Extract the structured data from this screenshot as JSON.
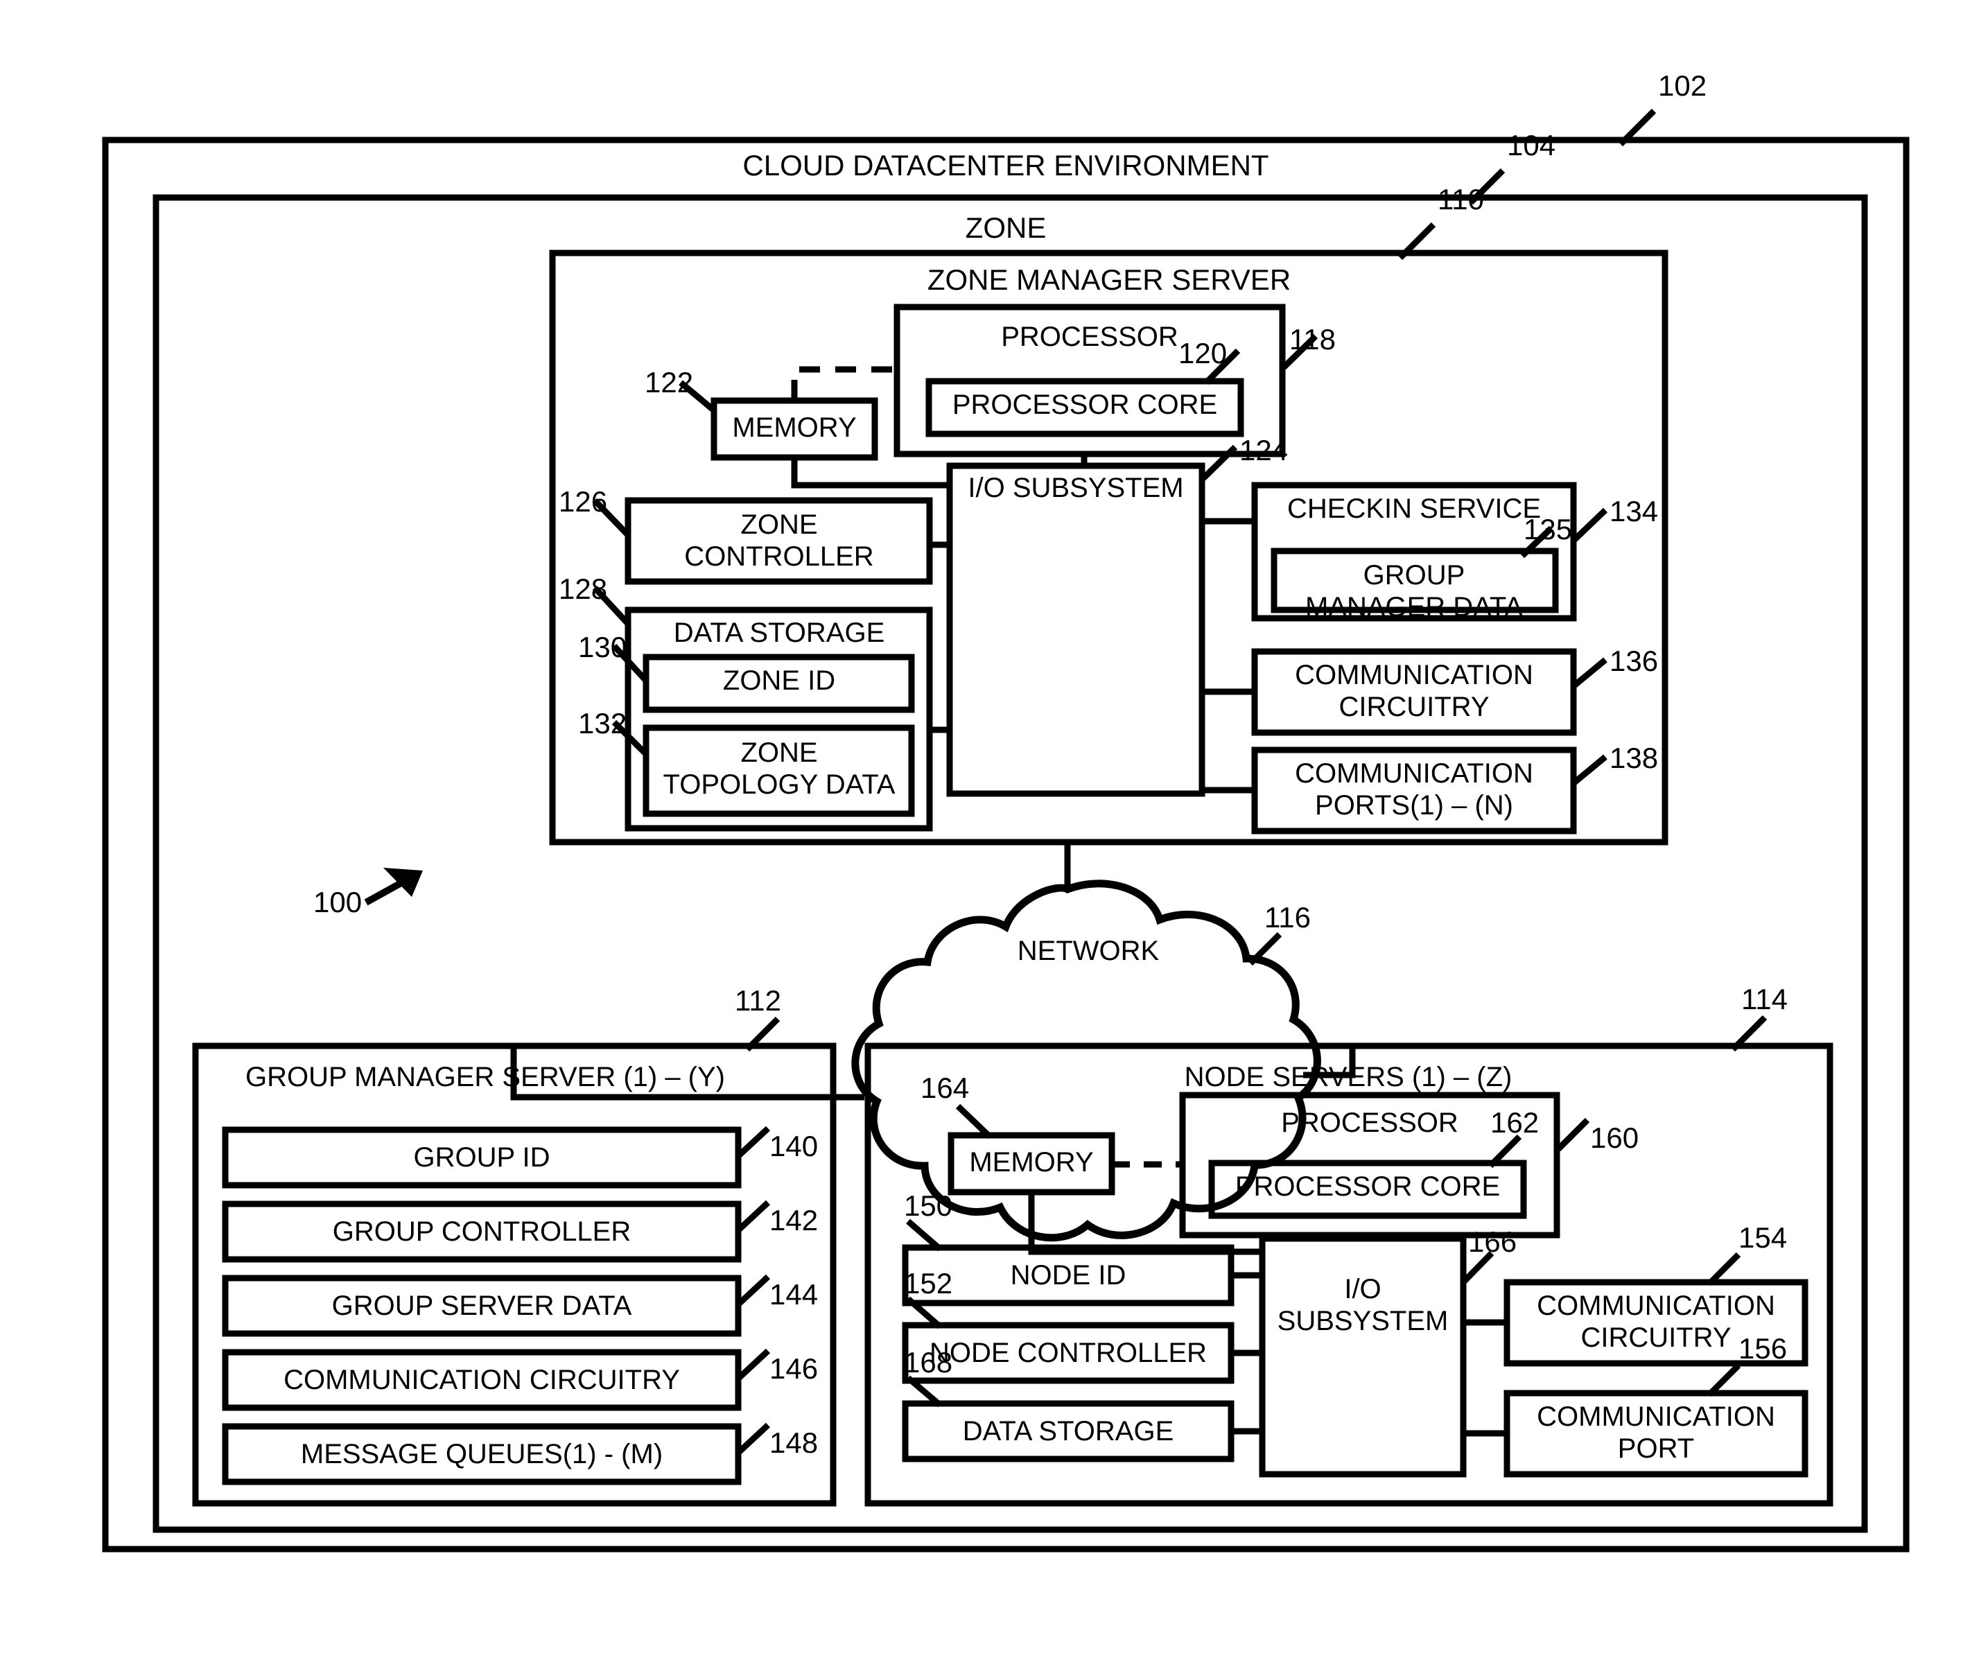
{
  "figure": {
    "title": "CLOUD DATACENTER ENVIRONMENT",
    "system_ref": "100",
    "refs": {
      "environment": "102",
      "zone": "104",
      "zone_manager_server": "110",
      "group_manager_server": "112",
      "node_servers": "114",
      "network": "116",
      "zm_processor": "118",
      "zm_processor_core": "120",
      "zm_memory": "122",
      "zm_io_subsystem": "124",
      "zm_zone_controller": "126",
      "zm_data_storage": "128",
      "zm_zone_id": "130",
      "zm_zone_topology_data": "132",
      "zm_checkin_service": "134",
      "zm_group_manager_data": "135",
      "zm_comm_circuitry": "136",
      "zm_comm_ports": "138",
      "gm_group_id": "140",
      "gm_group_controller": "142",
      "gm_group_server_data": "144",
      "gm_comm_circuitry": "146",
      "gm_message_queues": "148",
      "ns_node_id": "150",
      "ns_node_controller": "152",
      "ns_comm_circuitry": "154",
      "ns_comm_port": "156",
      "ns_processor": "160",
      "ns_processor_core": "162",
      "ns_memory": "164",
      "ns_io_subsystem": "166",
      "ns_data_storage": "168"
    }
  },
  "environment": {
    "label": "CLOUD DATACENTER ENVIRONMENT"
  },
  "zone": {
    "label": "ZONE"
  },
  "zone_manager_server": {
    "label": "ZONE MANAGER SERVER",
    "processor": {
      "label": "PROCESSOR",
      "core_label": "PROCESSOR CORE"
    },
    "memory": {
      "label": "MEMORY"
    },
    "io_subsystem": {
      "label": "I/O SUBSYSTEM"
    },
    "zone_controller": {
      "line1": "ZONE",
      "line2": "CONTROLLER"
    },
    "data_storage": {
      "label": "DATA STORAGE",
      "zone_id": "ZONE ID",
      "topology_line1": "ZONE",
      "topology_line2": "TOPOLOGY DATA"
    },
    "checkin_service": {
      "label": "CHECKIN SERVICE",
      "group_manager_data_line1": "GROUP",
      "group_manager_data_line2": "MANAGER DATA"
    },
    "comm_circuitry": {
      "line1": "COMMUNICATION",
      "line2": "CIRCUITRY"
    },
    "comm_ports": {
      "line1": "COMMUNICATION",
      "line2": "PORTS(1) – (N)"
    }
  },
  "network": {
    "label": "NETWORK"
  },
  "group_manager_server": {
    "label": "GROUP MANAGER SERVER (1) – (Y)",
    "items": [
      {
        "label": "GROUP ID",
        "ref": "140"
      },
      {
        "label": "GROUP CONTROLLER",
        "ref": "142"
      },
      {
        "label": "GROUP SERVER DATA",
        "ref": "144"
      },
      {
        "label": "COMMUNICATION CIRCUITRY",
        "ref": "146"
      },
      {
        "label": "MESSAGE QUEUES(1) - (M)",
        "ref": "148"
      }
    ]
  },
  "node_servers": {
    "label": "NODE SERVERS (1) – (Z)",
    "processor": {
      "label": "PROCESSOR",
      "core_label": "PROCESSOR CORE"
    },
    "memory": {
      "label": "MEMORY"
    },
    "io_subsystem": {
      "line1": "I/O",
      "line2": "SUBSYSTEM"
    },
    "node_id": {
      "label": "NODE ID"
    },
    "node_controller": {
      "label": "NODE CONTROLLER"
    },
    "data_storage": {
      "label": "DATA STORAGE"
    },
    "comm_circuitry": {
      "line1": "COMMUNICATION",
      "line2": "CIRCUITRY"
    },
    "comm_port": {
      "line1": "COMMUNICATION",
      "line2": "PORT"
    }
  },
  "colors": {
    "stroke": "#000000",
    "background": "#ffffff"
  }
}
